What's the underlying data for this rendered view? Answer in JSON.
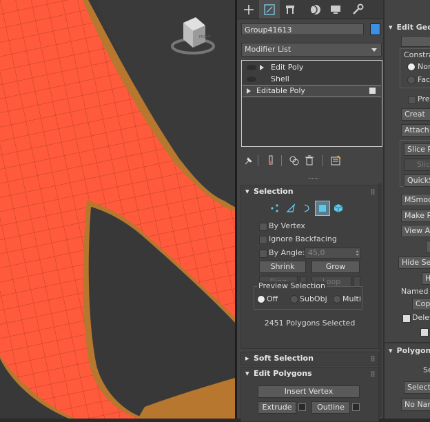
{
  "colors": {
    "mesh": "#ff5a3c",
    "wire": "#b83a28",
    "shell": "#b8772e",
    "bg": "#3a3a3a",
    "accent": "#3d8fe0",
    "active_mode": "#5a7c8c"
  },
  "viewport": {
    "viewcube_label": "FRONT"
  },
  "command_tabs": [
    {
      "icon": "create-plus-icon"
    },
    {
      "icon": "modify-icon"
    },
    {
      "icon": "hierarchy-icon"
    },
    {
      "icon": "motion-icon"
    },
    {
      "icon": "display-icon"
    },
    {
      "icon": "utilities-wrench-icon"
    }
  ],
  "object_name": "Group41613",
  "modifier_list": "Modifier List",
  "stack": [
    {
      "label": "Edit Poly",
      "expandable": true,
      "selected": false
    },
    {
      "label": "Shell",
      "expandable": false,
      "selected": false
    },
    {
      "label": "Editable Poly",
      "expandable": true,
      "selected": true
    }
  ],
  "selection": {
    "title": "Selection",
    "modes": [
      "vertex-icon",
      "edge-icon",
      "border-icon",
      "polygon-icon",
      "element-icon"
    ],
    "active_mode": "polygon-icon",
    "by_vertex": "By Vertex",
    "ignore_backfacing": "Ignore Backfacing",
    "by_angle": "By Angle:",
    "angle_value": "45,0",
    "shrink": "Shrink",
    "grow": "Grow",
    "ring": "Ring",
    "loop": "Loop",
    "preview_title": "Preview Selection",
    "preview_options": [
      "Off",
      "SubObj",
      "Multi"
    ],
    "preview_selected": "Off",
    "status": "2451 Polygons Selected"
  },
  "soft_selection": {
    "title": "Soft Selection"
  },
  "edit_polygons": {
    "title": "Edit Polygons",
    "insert_vertex": "Insert Vertex",
    "extrude": "Extrude",
    "outline": "Outline"
  },
  "right_panel": {
    "edit_geometry": "Edit Geom",
    "constraints": "Constrai",
    "none": "Non",
    "face": "Fac",
    "preserve": "Pres",
    "create": "Creat",
    "attach": "Attach",
    "slice_plane": "Slice Pl",
    "slice": "Slice",
    "quickslice": "QuickS",
    "msmooth": "MSmoot",
    "make_planar": "Make P",
    "view_align": "View A",
    "hide_selected": "Hide Sele",
    "hide": "Hi",
    "named_selections": "Named S",
    "copy": "Copy",
    "delete": "Delete",
    "polygon_section": "Polygon:",
    "se": "Se",
    "select": "Select",
    "no_name": "No Nam"
  }
}
